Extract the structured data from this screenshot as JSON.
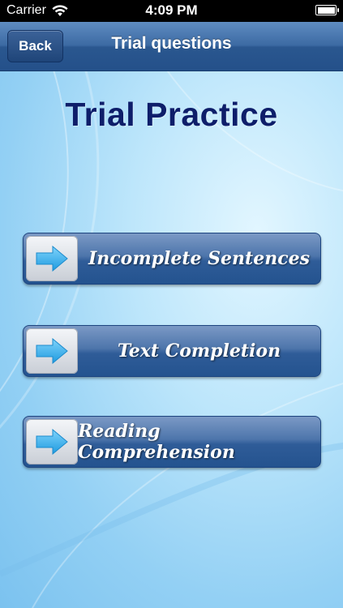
{
  "status_bar": {
    "carrier": "Carrier",
    "time": "4:09 PM"
  },
  "nav_bar": {
    "back_label": "Back",
    "title": "Trial questions"
  },
  "main": {
    "heading": "Trial Practice",
    "buttons": [
      {
        "label": "Incomplete Sentences",
        "icon": "arrow-right-icon"
      },
      {
        "label": "Text Completion",
        "icon": "arrow-right-icon"
      },
      {
        "label": "Reading Comprehension",
        "icon": "arrow-right-icon"
      }
    ]
  },
  "colors": {
    "nav": "#3c6aa3",
    "heading": "#0e1e6a",
    "arrow": "#2aa8e8"
  }
}
